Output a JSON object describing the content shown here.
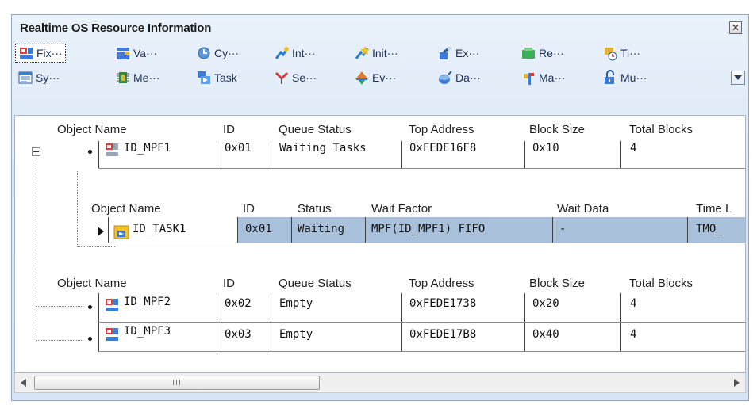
{
  "window": {
    "title": "Realtime OS Resource Information"
  },
  "toolbar": {
    "row1": [
      "Fix···",
      "Va···",
      "Cy···",
      "Int···",
      "Init···",
      "Ex···",
      "Re···",
      "Ti···"
    ],
    "row2": [
      "Sy···",
      "Me···",
      "Task",
      "Se···",
      "Ev···",
      "Da···",
      "Ma···",
      "Mu···"
    ]
  },
  "table1": {
    "headers": [
      "Object Name",
      "ID",
      "Queue Status",
      "Top Address",
      "Block Size",
      "Total Blocks"
    ],
    "rows": [
      [
        "ID_MPF1",
        "0x01",
        "Waiting Tasks",
        "0xFEDE16F8",
        "0x10",
        "4"
      ]
    ]
  },
  "subtable": {
    "headers": [
      "Object Name",
      "ID",
      "Status",
      "Wait Factor",
      "Wait Data",
      "Time L"
    ],
    "rows": [
      [
        "ID_TASK1",
        "0x01",
        "Waiting",
        "MPF(ID_MPF1) FIFO",
        "-",
        "TMO_"
      ]
    ]
  },
  "table2": {
    "headers": [
      "Object Name",
      "ID",
      "Queue Status",
      "Top Address",
      "Block Size",
      "Total Blocks"
    ],
    "rows": [
      [
        "ID_MPF2",
        "0x02",
        "Empty",
        "0xFEDE1738",
        "0x20",
        "4"
      ],
      [
        "ID_MPF3",
        "0x03",
        "Empty",
        "0xFEDE17B8",
        "0x40",
        "4"
      ]
    ]
  },
  "scrollbar": {
    "thumb_grip": "III"
  },
  "colors": {
    "selection": "#a9c0da",
    "title_bg": "#dbe8f7",
    "toolbar_text": "#1f2f57"
  }
}
